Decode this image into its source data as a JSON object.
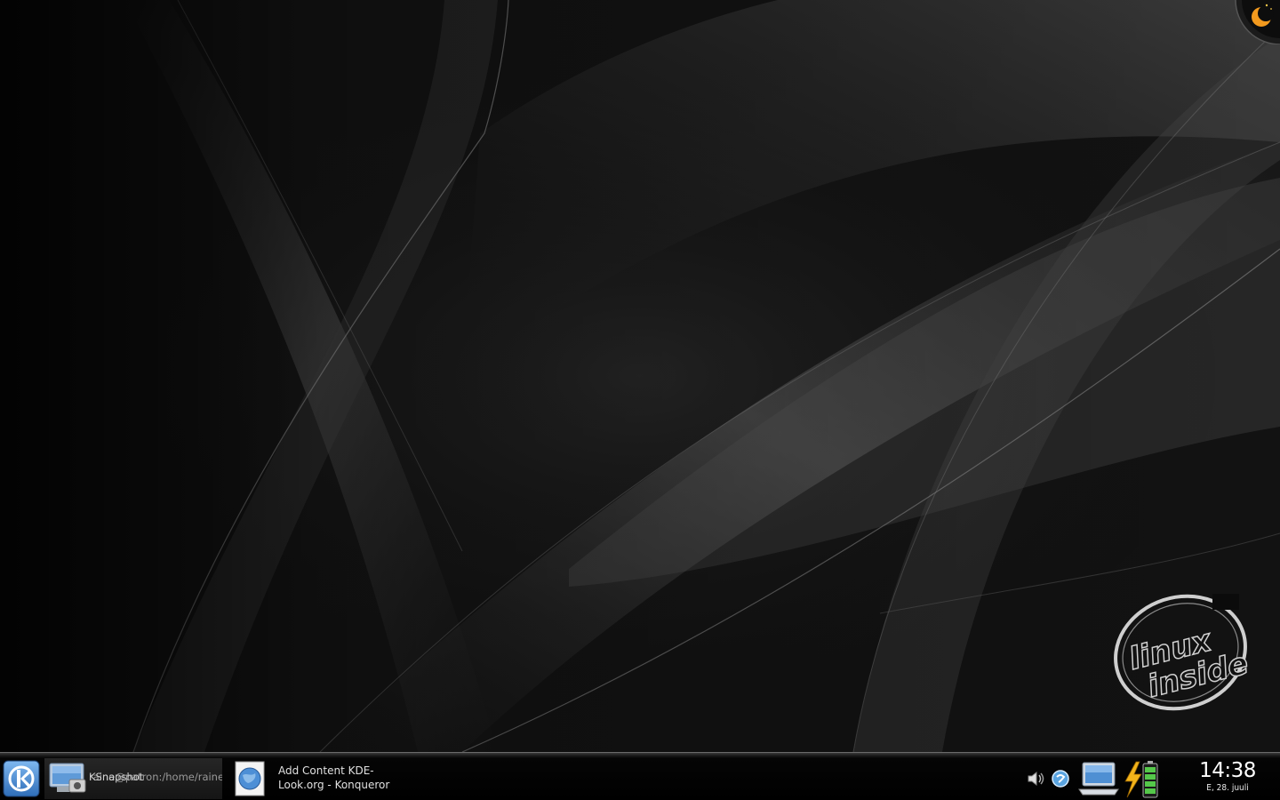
{
  "desktop": {
    "logo_text_line1": "linux",
    "logo_text_line2": "inside"
  },
  "taskbar": {
    "kmenu_icon": "kde-k-icon",
    "tasks": [
      {
        "label_back": "KSnapshot",
        "label_front": "raine@patron:/home/raine",
        "icon": "terminal-snapshot-icon",
        "active": true
      },
      {
        "label": "Add Content KDE-Look.org - Konqueror",
        "label_line1": "Add Content KDE-",
        "label_line2": "Look.org - Konqueror",
        "icon": "konqueror-globe-icon",
        "active": false
      }
    ],
    "tray": [
      {
        "icon": "speaker-volume-icon"
      },
      {
        "icon": "klipper-clipboard-icon"
      },
      {
        "icon": "network-laptop-icon"
      },
      {
        "icon": "battery-power-icon"
      }
    ],
    "clock": {
      "time": "14:38",
      "date": "E, 28. juuli"
    }
  },
  "colors": {
    "background": "#0a0a0a",
    "taskbar": "#000000",
    "accent_orange": "#f39a1e"
  }
}
